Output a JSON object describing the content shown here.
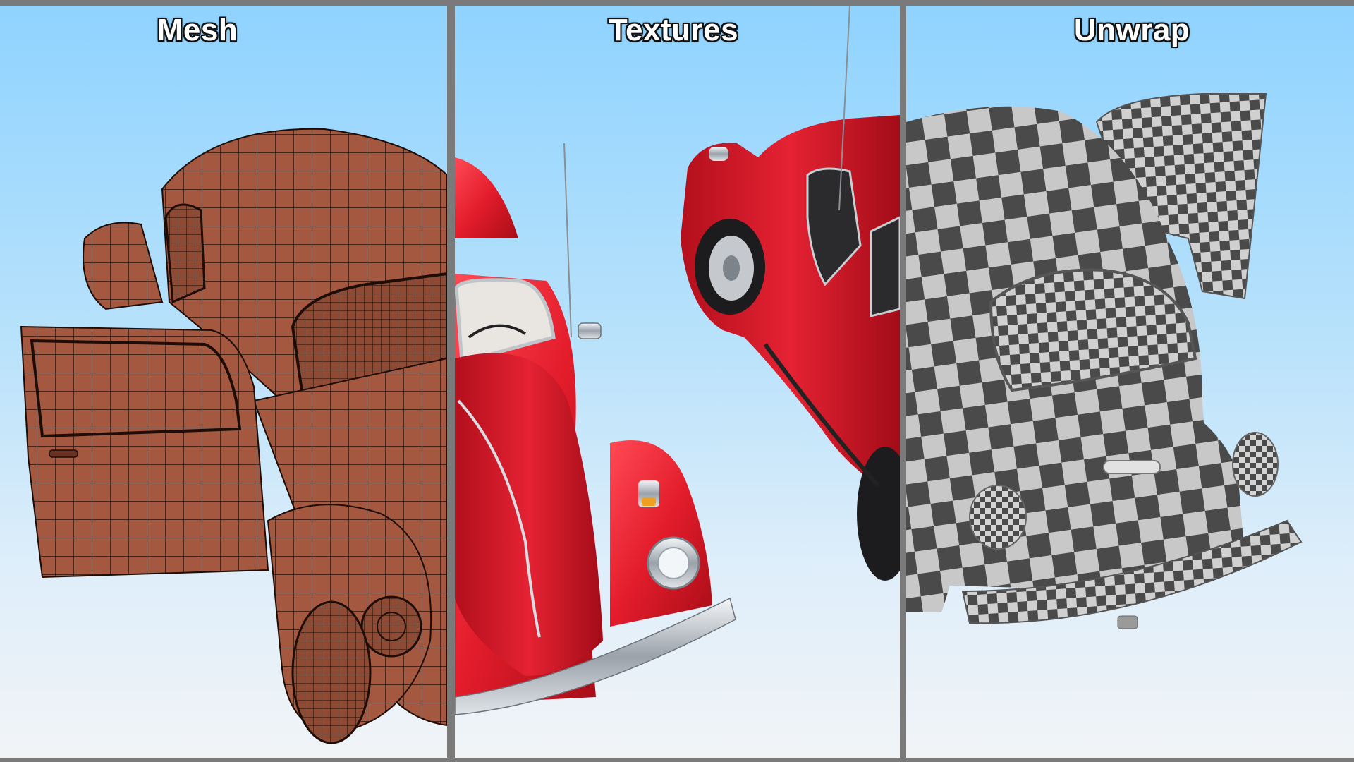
{
  "panels": [
    {
      "title": "Mesh",
      "view": "wireframe"
    },
    {
      "title": "Textures",
      "view": "textured"
    },
    {
      "title": "Unwrap",
      "view": "checker-uv"
    }
  ],
  "colors": {
    "frame": "#7a7a7a",
    "sky_top": "#8fd3ff",
    "sky_bottom": "#f1f4f7",
    "mesh_body": "#a4583f",
    "mesh_wire": "#2a120a",
    "paint_red": "#e0202e",
    "chrome": "#d8dde2",
    "checker_dark": "#4a4a4a",
    "checker_light": "#c8c8c8"
  }
}
